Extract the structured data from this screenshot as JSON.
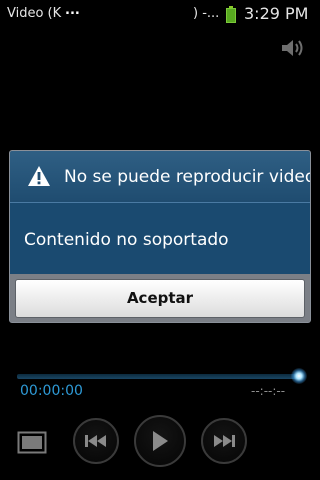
{
  "status_bar": {
    "title": "Video (K",
    "ellipsis": "...",
    "title_suffix": ") -...",
    "time": "3:29 PM",
    "battery_color": "#58a920"
  },
  "player": {
    "volume_icon": "speaker-icon",
    "elapsed": "00:00:00",
    "total": "--:--:--",
    "progress_color": "#2e9ad6"
  },
  "dialog": {
    "icon": "warning-icon",
    "title": "No se puede reproducir video",
    "message": "Contenido no soportado",
    "accept_label": "Aceptar",
    "header_color": "#1f4c70"
  },
  "controls": {
    "screen_mode_icon": "screen-mode-icon",
    "rewind_icon": "rewind-icon",
    "play_icon": "play-icon",
    "fast_forward_icon": "fast-forward-icon"
  }
}
